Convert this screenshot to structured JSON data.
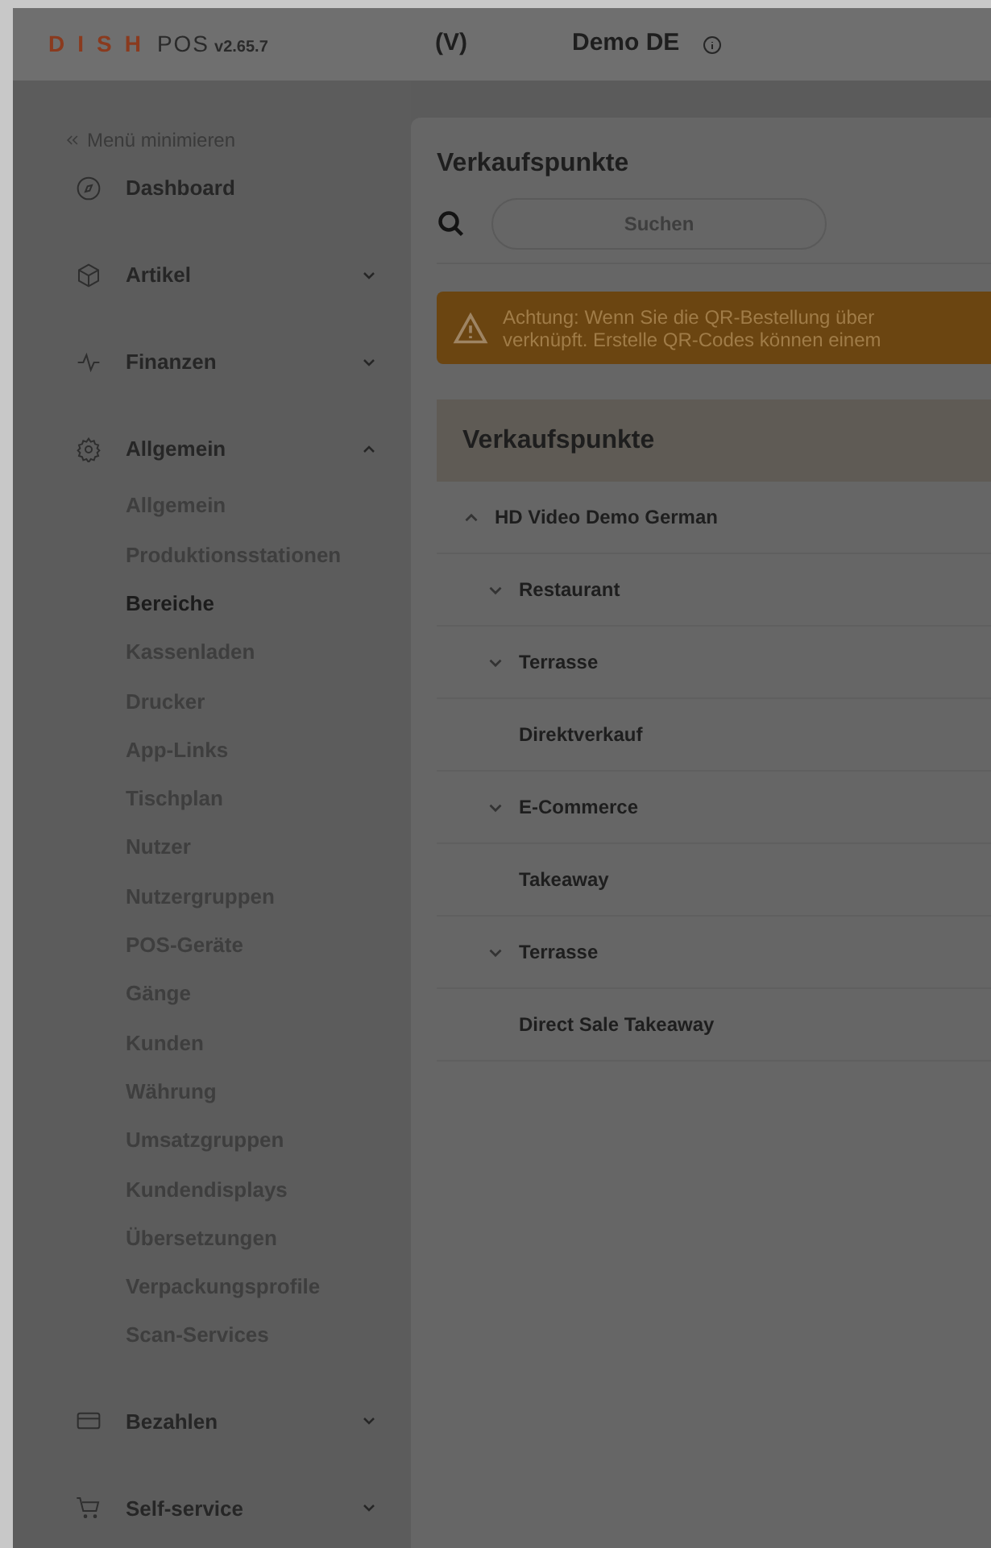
{
  "header": {
    "logo_brand": "DISH",
    "logo_product": "POS",
    "version": "v2.65.7",
    "mode": "(V)",
    "account": "Demo DE"
  },
  "sidebar": {
    "minimize": "Menü minimieren",
    "items": [
      {
        "label": "Dashboard",
        "kind": "link"
      },
      {
        "label": "Artikel",
        "kind": "group",
        "expanded": false
      },
      {
        "label": "Finanzen",
        "kind": "group",
        "expanded": false
      },
      {
        "label": "Allgemein",
        "kind": "group",
        "expanded": true,
        "children": [
          {
            "label": "Allgemein",
            "selected": false
          },
          {
            "label": "Produktionsstationen",
            "selected": false
          },
          {
            "label": "Bereiche",
            "selected": true
          },
          {
            "label": "Kassenladen",
            "selected": false
          },
          {
            "label": "Drucker",
            "selected": false
          },
          {
            "label": "App-Links",
            "selected": false
          },
          {
            "label": "Tischplan",
            "selected": false
          },
          {
            "label": "Nutzer",
            "selected": false
          },
          {
            "label": "Nutzergruppen",
            "selected": false
          },
          {
            "label": "POS-Geräte",
            "selected": false
          },
          {
            "label": "Gänge",
            "selected": false
          },
          {
            "label": "Kunden",
            "selected": false
          },
          {
            "label": "Währung",
            "selected": false
          },
          {
            "label": "Umsatzgruppen",
            "selected": false
          },
          {
            "label": "Kundendisplays",
            "selected": false
          },
          {
            "label": "Übersetzungen",
            "selected": false
          },
          {
            "label": "Verpackungsprofile",
            "selected": false
          },
          {
            "label": "Scan-Services",
            "selected": false
          }
        ]
      },
      {
        "label": "Bezahlen",
        "kind": "group",
        "expanded": false
      },
      {
        "label": "Self-service",
        "kind": "group",
        "expanded": false
      }
    ]
  },
  "main": {
    "title": "Verkaufspunkte",
    "search": {
      "placeholder": "Suchen"
    },
    "alert": {
      "lines": [
        "Achtung: Wenn Sie die QR-Bestellung über",
        "verknüpft. Erstelle QR-Codes können einem"
      ]
    },
    "tree": {
      "heading": "Verkaufspunkte",
      "nodes": [
        {
          "label": "HD Video Demo German",
          "expanded": true,
          "children": [
            {
              "label": "Restaurant",
              "expanded": false
            },
            {
              "label": "Terrasse",
              "expanded": false
            },
            {
              "label": "Direktverkauf"
            },
            {
              "label": "E-Commerce",
              "expanded": false
            },
            {
              "label": "Takeaway"
            },
            {
              "label": "Terrasse",
              "expanded": false
            },
            {
              "label": "Direct Sale Takeaway"
            }
          ]
        }
      ]
    }
  }
}
